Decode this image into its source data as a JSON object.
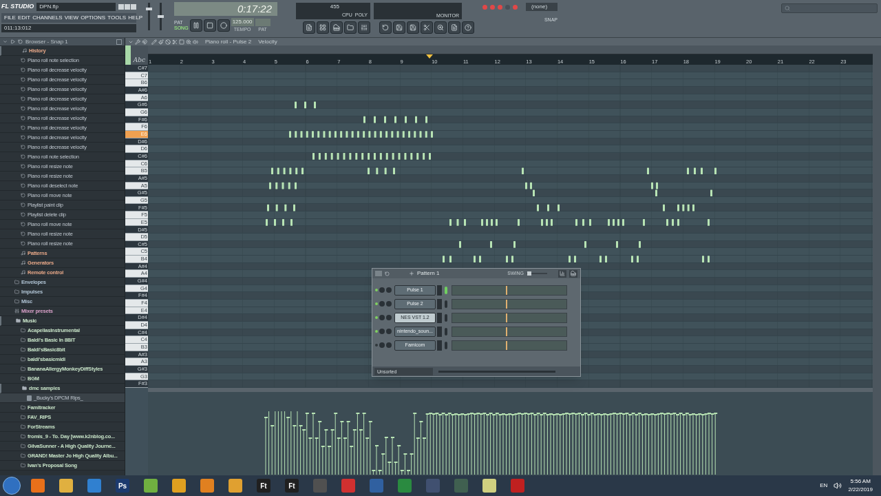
{
  "app": {
    "logo": "FL STUDIO",
    "file": "DPN.flp",
    "hint": "011:13:012"
  },
  "menu": [
    "FILE",
    "EDIT",
    "CHANNELS",
    "VIEW",
    "OPTIONS",
    "TOOLS",
    "HELP"
  ],
  "mixer": {
    "master_volume": {
      "level": 0.8
    },
    "master_pitch": {
      "level": 0.5
    }
  },
  "transport": {
    "pat": "PAT",
    "song": "SONG",
    "pat_selected": false,
    "song_selected": true,
    "time": "0:17:22",
    "tempo": "125.000",
    "tempo_label": "TEMPO",
    "pat_label": "PAT"
  },
  "monitor": {
    "value": "455",
    "cpu": "CPU",
    "poly": "POLY",
    "label": "MONITOR"
  },
  "snap": {
    "value": "(none)",
    "label": "SNAP"
  },
  "browser": {
    "title": "Browser - Snap 1",
    "tree": [
      {
        "label": "History",
        "kind": "project",
        "expanded": true,
        "children": [
          {
            "label": "Piano roll note selection",
            "kind": "history"
          },
          {
            "label": "Piano roll decrease velocity",
            "kind": "history"
          },
          {
            "label": "Piano roll decrease velocity",
            "kind": "history"
          },
          {
            "label": "Piano roll decrease velocity",
            "kind": "history"
          },
          {
            "label": "Piano roll decrease velocity",
            "kind": "history"
          },
          {
            "label": "Piano roll decrease velocity",
            "kind": "history"
          },
          {
            "label": "Piano roll decrease velocity",
            "kind": "history"
          },
          {
            "label": "Piano roll decrease velocity",
            "kind": "history"
          },
          {
            "label": "Piano roll decrease velocity",
            "kind": "history"
          },
          {
            "label": "Piano roll decrease velocity",
            "kind": "history"
          },
          {
            "label": "Piano roll note selection",
            "kind": "history"
          },
          {
            "label": "Piano roll resize note",
            "kind": "history"
          },
          {
            "label": "Piano roll resize note",
            "kind": "history"
          },
          {
            "label": "Piano roll deselect note",
            "kind": "history"
          },
          {
            "label": "Piano roll move note",
            "kind": "history"
          },
          {
            "label": "Playlist paint clip",
            "kind": "history"
          },
          {
            "label": "Playlist delete clip",
            "kind": "history"
          },
          {
            "label": "Piano roll move note",
            "kind": "history"
          },
          {
            "label": "Piano roll resize note",
            "kind": "history"
          },
          {
            "label": "Piano roll resize note",
            "kind": "history"
          }
        ]
      },
      {
        "label": "Patterns",
        "kind": "project",
        "expanded": false
      },
      {
        "label": "Generators",
        "kind": "project",
        "expanded": false
      },
      {
        "label": "Remote control",
        "kind": "project",
        "expanded": false
      },
      {
        "label": "Envelopes",
        "kind": "folder",
        "expanded": false
      },
      {
        "label": "Impulses",
        "kind": "folder",
        "expanded": false
      },
      {
        "label": "Misc",
        "kind": "folder",
        "expanded": false
      },
      {
        "label": "Mixer presets",
        "kind": "presets",
        "expanded": false
      },
      {
        "label": "Music",
        "kind": "folder",
        "expanded": true,
        "children": [
          {
            "label": "AcapellasInstrumental",
            "kind": "folder",
            "expanded": false
          },
          {
            "label": "Baldi's Basic In 8BIT",
            "kind": "folder",
            "expanded": false
          },
          {
            "label": "Baldi'sBasic8bit",
            "kind": "folder",
            "expanded": false
          },
          {
            "label": "baldi'sbasicmidi",
            "kind": "folder",
            "expanded": false
          },
          {
            "label": "BananaAllergyMonkeyDiffStyles",
            "kind": "folder",
            "expanded": false
          },
          {
            "label": "BGM",
            "kind": "folder",
            "expanded": false
          },
          {
            "label": "dmc samples",
            "kind": "folder",
            "expanded": true,
            "children": [
              {
                "label": "_Bucky's DPCM Rips_",
                "kind": "file"
              }
            ]
          },
          {
            "label": "Famitracker",
            "kind": "folder",
            "expanded": false
          },
          {
            "label": "FAV_RIPS",
            "kind": "folder",
            "expanded": false
          },
          {
            "label": "ForStreams",
            "kind": "folder",
            "expanded": false
          },
          {
            "label": "fromis_9 - To. Day [www.k2nblog.co...",
            "kind": "folder",
            "expanded": false
          },
          {
            "label": "GilvaSunner - A High Quality Journe...",
            "kind": "folder",
            "expanded": false
          },
          {
            "label": "GRAND! Master Jo High Quality Albu...",
            "kind": "folder",
            "expanded": false
          },
          {
            "label": "Ivan's Proposal Song",
            "kind": "folder",
            "expanded": false
          }
        ]
      }
    ]
  },
  "piano_roll": {
    "title": "Piano roll - Pulse 2",
    "target": "Velocity",
    "key_label": "Abc",
    "ruler": [
      "1",
      "2",
      "3",
      "4",
      "5",
      "6",
      "7",
      "8",
      "9",
      "10",
      "11",
      "12",
      "13",
      "14",
      "15",
      "16",
      "17",
      "18",
      "19",
      "20",
      "21",
      "22",
      "23"
    ],
    "keys": [
      {
        "label": "C#7",
        "kind": "black",
        "selected": false
      },
      {
        "label": "C7",
        "kind": "white",
        "selected": false
      },
      {
        "label": "B6",
        "kind": "white",
        "selected": false
      },
      {
        "label": "A#6",
        "kind": "black",
        "selected": false
      },
      {
        "label": "A6",
        "kind": "white",
        "selected": false
      },
      {
        "label": "G#6",
        "kind": "black",
        "selected": false
      },
      {
        "label": "G6",
        "kind": "white",
        "selected": false
      },
      {
        "label": "F#6",
        "kind": "black",
        "selected": false
      },
      {
        "label": "F6",
        "kind": "white",
        "selected": false
      },
      {
        "label": "E6",
        "kind": "white",
        "selected": true
      },
      {
        "label": "D#6",
        "kind": "black",
        "selected": false
      },
      {
        "label": "D6",
        "kind": "white",
        "selected": false
      },
      {
        "label": "C#6",
        "kind": "black",
        "selected": false
      },
      {
        "label": "C6",
        "kind": "white",
        "selected": false
      },
      {
        "label": "B5",
        "kind": "white",
        "selected": false
      },
      {
        "label": "A#5",
        "kind": "black",
        "selected": false
      },
      {
        "label": "A5",
        "kind": "white",
        "selected": false
      },
      {
        "label": "G#5",
        "kind": "black",
        "selected": false
      },
      {
        "label": "G5",
        "kind": "white",
        "selected": false
      },
      {
        "label": "F#5",
        "kind": "black",
        "selected": false
      },
      {
        "label": "F5",
        "kind": "white",
        "selected": false
      },
      {
        "label": "E5",
        "kind": "white",
        "selected": false
      },
      {
        "label": "D#5",
        "kind": "black",
        "selected": false
      },
      {
        "label": "D5",
        "kind": "white",
        "selected": false
      },
      {
        "label": "C#5",
        "kind": "black",
        "selected": false
      },
      {
        "label": "C5",
        "kind": "white",
        "selected": false
      },
      {
        "label": "B4",
        "kind": "white",
        "selected": false
      },
      {
        "label": "A#4",
        "kind": "black",
        "selected": false
      },
      {
        "label": "A4",
        "kind": "white",
        "selected": false
      },
      {
        "label": "G#4",
        "kind": "black",
        "selected": false
      },
      {
        "label": "G4",
        "kind": "white",
        "selected": false
      },
      {
        "label": "F#4",
        "kind": "black",
        "selected": false
      },
      {
        "label": "F4",
        "kind": "white",
        "selected": false
      },
      {
        "label": "E4",
        "kind": "white",
        "selected": false
      },
      {
        "label": "D#4",
        "kind": "black",
        "selected": false
      },
      {
        "label": "D4",
        "kind": "white",
        "selected": false
      },
      {
        "label": "C#4",
        "kind": "black",
        "selected": false
      },
      {
        "label": "C4",
        "kind": "white",
        "selected": false
      },
      {
        "label": "B3",
        "kind": "white",
        "selected": false
      },
      {
        "label": "A#3",
        "kind": "black",
        "selected": false
      },
      {
        "label": "A3",
        "kind": "white",
        "selected": false
      },
      {
        "label": "G#3",
        "kind": "black",
        "selected": false
      },
      {
        "label": "G3",
        "kind": "white",
        "selected": false
      },
      {
        "label": "F#3",
        "kind": "black",
        "selected": false
      }
    ]
  },
  "pattern_window": {
    "title": "Pattern 1",
    "swing": {
      "label": "SWING",
      "level": 0.05
    },
    "filter": "Unsorted",
    "channels": [
      {
        "name": "Pulse 1",
        "enabled": true,
        "selected": false,
        "led_on": true
      },
      {
        "name": "Pulse 2",
        "enabled": true,
        "selected": false,
        "led_on": false
      },
      {
        "name": "NES VST 1.2",
        "enabled": true,
        "selected": true,
        "led_on": false
      },
      {
        "name": "nintendo_soun...",
        "enabled": true,
        "selected": false,
        "led_on": false
      },
      {
        "name": "Famicom",
        "enabled": false,
        "selected": false,
        "led_on": false
      }
    ]
  },
  "taskbar": {
    "apps": [
      {
        "color": "#e8701a"
      },
      {
        "color": "#e0b040"
      },
      {
        "color": "#3080d0"
      },
      {
        "color": "#1c3a6e",
        "label": "Ps"
      },
      {
        "color": "#70b040"
      },
      {
        "color": "#e0a020"
      },
      {
        "color": "#e08020"
      },
      {
        "color": "#e0a030"
      },
      {
        "color": "#202020",
        "label": "Ft"
      },
      {
        "color": "#202020",
        "label": "Ft"
      },
      {
        "color": "#505050"
      },
      {
        "color": "#d03030"
      },
      {
        "color": "#3060a0"
      },
      {
        "color": "#2a8a40"
      },
      {
        "color": "#405070"
      },
      {
        "color": "#406050"
      },
      {
        "color": "#d0d080"
      },
      {
        "color": "#c02020"
      }
    ],
    "language": "EN",
    "time": "5:56 AM",
    "date": "2/22/2019"
  }
}
